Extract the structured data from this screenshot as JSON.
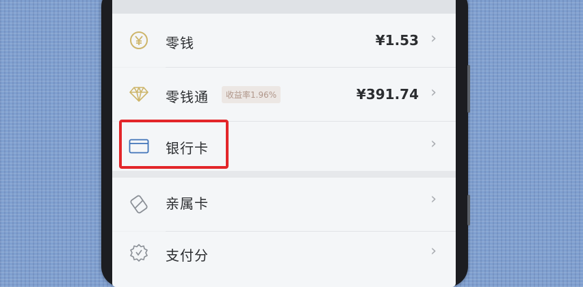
{
  "wallet": {
    "items": [
      {
        "label": "零钱",
        "amount": "¥1.53",
        "icon": "yuan-coin-icon"
      },
      {
        "label": "零钱通",
        "tag": "收益率1.96%",
        "amount": "¥391.74",
        "icon": "diamond-icon"
      },
      {
        "label": "银行卡",
        "icon": "bank-card-icon"
      },
      {
        "label": "亲属卡",
        "icon": "family-card-icon"
      },
      {
        "label": "支付分",
        "icon": "payscore-gear-icon"
      }
    ],
    "chevron": "›"
  },
  "colors": {
    "highlight": "#e3262a",
    "icon_gold": "#cdb56a",
    "icon_blue": "#3f73b8",
    "icon_gray": "#8a8f96",
    "tag_text": "#b0968a"
  }
}
